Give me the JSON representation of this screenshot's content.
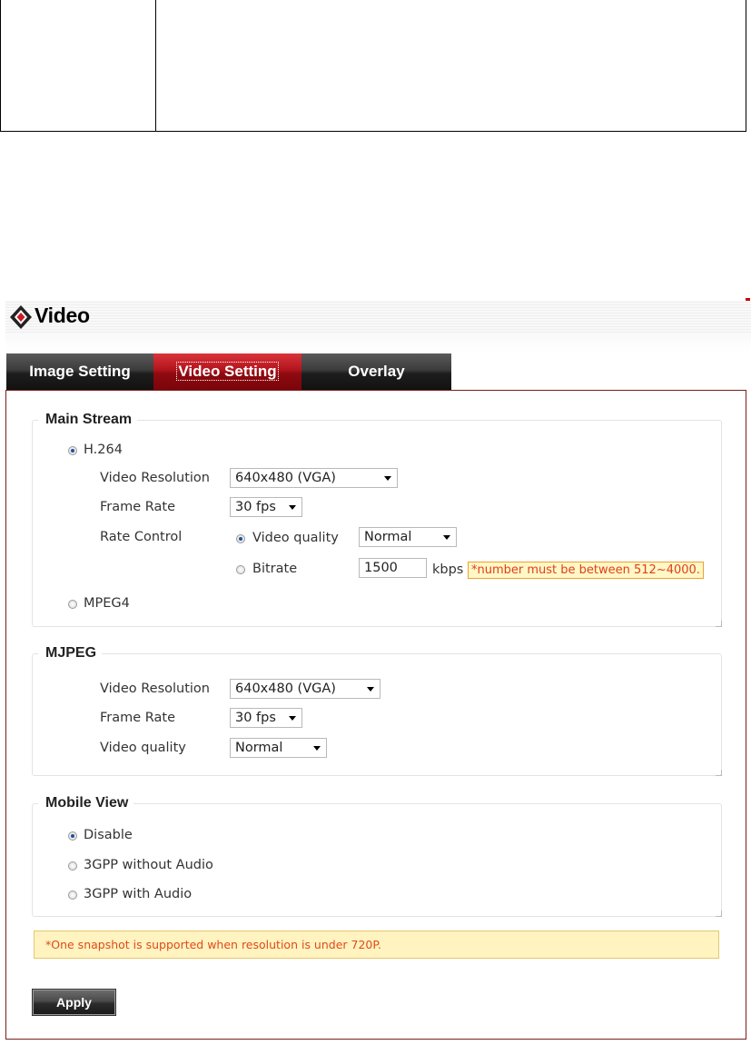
{
  "app": {
    "title": "Video",
    "accent_color": "#b3141c",
    "logo_icon": "red-diamond-logo-icon"
  },
  "tabs": [
    {
      "label": "Image Setting",
      "active": false
    },
    {
      "label": "Video Setting",
      "active": true
    },
    {
      "label": "Overlay",
      "active": false
    }
  ],
  "main_stream": {
    "legend": "Main Stream",
    "h264_label": "H.264",
    "h264_selected": true,
    "video_resolution_label": "Video Resolution",
    "video_resolution_value": "640x480 (VGA)",
    "frame_rate_label": "Frame Rate",
    "frame_rate_value": "30 fps",
    "rate_control_label": "Rate Control",
    "video_quality_label": "Video quality",
    "video_quality_selected": true,
    "video_quality_value": "Normal",
    "bitrate_label": "Bitrate",
    "bitrate_selected": false,
    "bitrate_value": "1500",
    "bitrate_unit": "kbps",
    "bitrate_hint": "*number must be between 512~4000.",
    "mpeg4_label": "MPEG4",
    "mpeg4_selected": false
  },
  "mjpeg": {
    "legend": "MJPEG",
    "video_resolution_label": "Video Resolution",
    "video_resolution_value": "640x480 (VGA)",
    "frame_rate_label": "Frame Rate",
    "frame_rate_value": "30 fps",
    "video_quality_label": "Video quality",
    "video_quality_value": "Normal"
  },
  "mobile_view": {
    "legend": "Mobile View",
    "options": [
      {
        "label": "Disable",
        "selected": true
      },
      {
        "label": "3GPP without Audio",
        "selected": false
      },
      {
        "label": "3GPP with Audio",
        "selected": false
      }
    ]
  },
  "snapshot_note": "*One snapshot is supported when resolution is under 720P.",
  "apply_label": "Apply"
}
